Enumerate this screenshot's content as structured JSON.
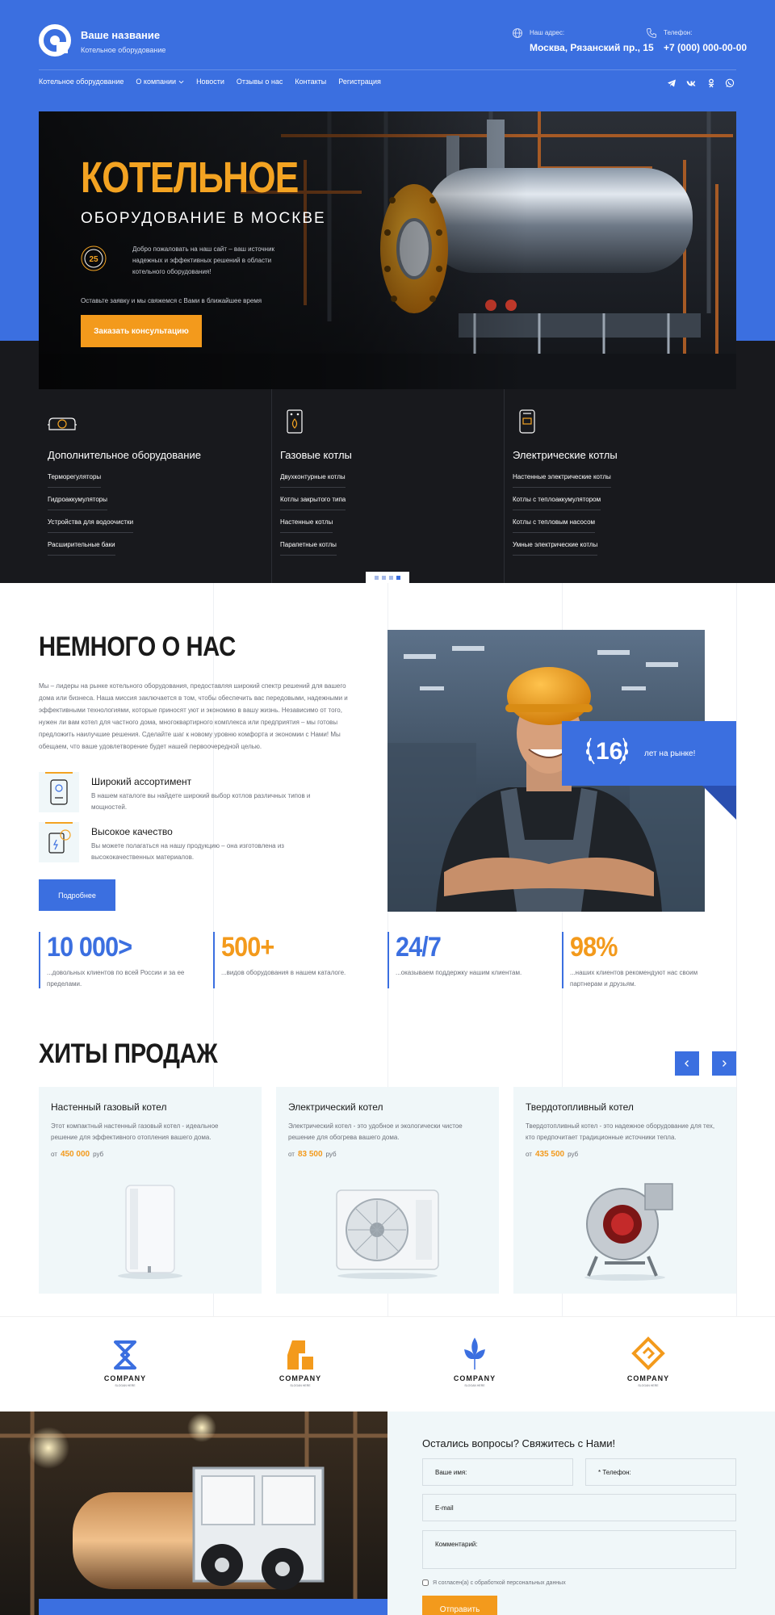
{
  "header": {
    "brand_name": "Ваше название",
    "brand_sub": "Котельное оборудование",
    "address_label": "Наш адрес:",
    "address_value": "Москва, Рязанский пр., 15",
    "phone_label": "Телефон:",
    "phone_value": "+7 (000) 000-00-00"
  },
  "nav": {
    "items": [
      "Котельное оборудование",
      "О компании",
      "Новости",
      "Отзывы о нас",
      "Контакты",
      "Регистрация"
    ],
    "social": [
      "telegram-icon",
      "vk-icon",
      "odnoklassniki-icon",
      "whatsapp-icon"
    ]
  },
  "hero": {
    "title": "КОТЕЛЬНОЕ",
    "subtitle": "ОБОРУДОВАНИЕ В МОСКВЕ",
    "badge": "25",
    "description": "Добро пожаловать на наш сайт – ваш источник надежных и эффективных решений в области котельного оборудования!",
    "note": "Оставьте заявку и мы свяжемся с Вами в ближайшее время",
    "button": "Заказать консультацию"
  },
  "categories": [
    {
      "title": "Дополнительное оборудование",
      "links": [
        "Терморегуляторы",
        "Гидроаккумуляторы",
        "Устройства для водоочистки",
        "Расширительные баки"
      ]
    },
    {
      "title": "Газовые котлы",
      "links": [
        "Двухконтурные котлы",
        "Котлы закрытого типа",
        "Настенные котлы",
        "Парапетные котлы"
      ]
    },
    {
      "title": "Электрические котлы",
      "links": [
        "Настенные электрические котлы",
        "Котлы с теплоаккумулятором",
        "Котлы с тепловым насосом",
        "Умные электрические котлы"
      ]
    }
  ],
  "slider": {
    "count": 4,
    "active": 3
  },
  "about": {
    "title": "НЕМНОГО О НАС",
    "text": "Мы – лидеры на рынке котельного оборудования, предоставляя широкий спектр решений для вашего дома или бизнеса. Наша миссия заключается в том, чтобы обеспечить вас передовыми, надежными и эффективными технологиями, которые приносят уют и экономию в вашу жизнь. Независимо от того, нужен ли вам котел для частного дома, многоквартирного комплекса или предприятия – мы готовы предложить наилучшие решения. Сделайте шаг к новому уровню комфорта и экономии с Нами! Мы обещаем, что ваше удовлетворение будет нашей первоочередной целью.",
    "features": [
      {
        "title": "Широкий ассортимент",
        "desc": "В нашем каталоге вы найдете широкий выбор котлов различных типов и мощностей."
      },
      {
        "title": "Высокое качество",
        "desc": "Вы можете полагаться на нашу продукцию – она изготовлена из высококачественных материалов."
      }
    ],
    "button": "Подробнее",
    "years_value": "16",
    "years_label": "лет на рынке!"
  },
  "stats": [
    {
      "value": "10 000>",
      "desc": "...довольных клиентов по всей России и за ее пределами.",
      "color": "#3b6fe0"
    },
    {
      "value": "500+",
      "desc": "...видов оборудования в нашем каталоге.",
      "color": "#f39a1c"
    },
    {
      "value": "24/7",
      "desc": "...оказываем поддержку нашим клиентам.",
      "color": "#3b6fe0"
    },
    {
      "value": "98%",
      "desc": "...наших клиентов рекомендуют нас своим партнерам и друзьям.",
      "color": "#f39a1c"
    }
  ],
  "hits": {
    "title": "ХИТЫ ПРОДАЖ",
    "price_prefix": "от",
    "currency": "руб",
    "products": [
      {
        "name": "Настенный газовый котел",
        "desc": "Этот компактный настенный газовый котел - идеальное решение для эффективного отопления вашего дома.",
        "price": "450 000"
      },
      {
        "name": "Электрический котел",
        "desc": "Электрический котел - это удобное и экологически чистое решение для обогрева вашего дома.",
        "price": "83 500"
      },
      {
        "name": "Твердотопливный котел",
        "desc": "Твердотопливный котел - это надежное оборудование для тех, кто предпочитает традиционные источники тепла.",
        "price": "435 500"
      }
    ]
  },
  "partners": {
    "label": "COMPANY",
    "slogan": "SLOGAN HERE",
    "colors": [
      "#3b6fe0",
      "#f39a1c",
      "#3b6fe0",
      "#f39a1c"
    ]
  },
  "contact": {
    "title": "Остались вопросы? Свяжитесь с Нами!",
    "name_placeholder": "Ваше имя:",
    "phone_placeholder": "* Телефон:",
    "email_placeholder": "E-mail",
    "comment_placeholder": "Комментарий:",
    "consent": "Я согласен(а) с обработкой персональных данных",
    "button": "Отправить"
  },
  "colors": {
    "accent_blue": "#3b6fe0",
    "accent_orange": "#f39a1c",
    "dark": "#18191d"
  }
}
